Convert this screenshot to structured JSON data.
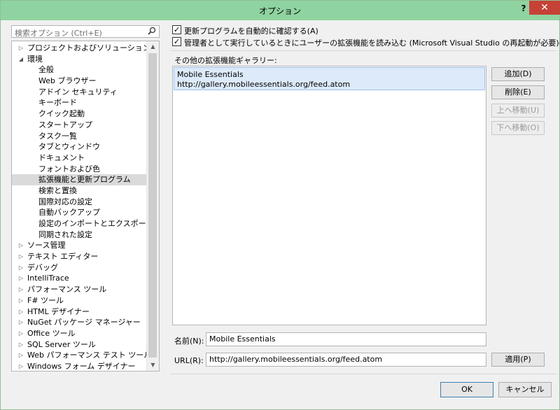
{
  "window": {
    "title": "オプション",
    "help": "?",
    "close": "✕"
  },
  "search": {
    "placeholder": "検索オプション (Ctrl+E)",
    "icon": "search-icon"
  },
  "tree": [
    {
      "label": "プロジェクトおよびソリューション",
      "level": 0,
      "arrow": "▷"
    },
    {
      "label": "環境",
      "level": 0,
      "arrow": "◢"
    },
    {
      "label": "全般",
      "level": 1,
      "arrow": ""
    },
    {
      "label": "Web ブラウザー",
      "level": 1,
      "arrow": ""
    },
    {
      "label": "アドイン セキュリティ",
      "level": 1,
      "arrow": ""
    },
    {
      "label": "キーボード",
      "level": 1,
      "arrow": ""
    },
    {
      "label": "クイック起動",
      "level": 1,
      "arrow": ""
    },
    {
      "label": "スタートアップ",
      "level": 1,
      "arrow": ""
    },
    {
      "label": "タスク一覧",
      "level": 1,
      "arrow": ""
    },
    {
      "label": "タブとウィンドウ",
      "level": 1,
      "arrow": ""
    },
    {
      "label": "ドキュメント",
      "level": 1,
      "arrow": ""
    },
    {
      "label": "フォントおよび色",
      "level": 1,
      "arrow": ""
    },
    {
      "label": "拡張機能と更新プログラム",
      "level": 1,
      "arrow": "",
      "selected": true
    },
    {
      "label": "検索と置換",
      "level": 1,
      "arrow": ""
    },
    {
      "label": "国際対応の設定",
      "level": 1,
      "arrow": ""
    },
    {
      "label": "自動バックアップ",
      "level": 1,
      "arrow": ""
    },
    {
      "label": "設定のインポートとエクスポート",
      "level": 1,
      "arrow": ""
    },
    {
      "label": "同期された設定",
      "level": 1,
      "arrow": ""
    },
    {
      "label": "ソース管理",
      "level": 0,
      "arrow": "▷"
    },
    {
      "label": "テキスト エディター",
      "level": 0,
      "arrow": "▷"
    },
    {
      "label": "デバッグ",
      "level": 0,
      "arrow": "▷"
    },
    {
      "label": "IntelliTrace",
      "level": 0,
      "arrow": "▷"
    },
    {
      "label": "パフォーマンス ツール",
      "level": 0,
      "arrow": "▷"
    },
    {
      "label": "F# ツール",
      "level": 0,
      "arrow": "▷"
    },
    {
      "label": "HTML デザイナー",
      "level": 0,
      "arrow": "▷"
    },
    {
      "label": "NuGet パッケージ マネージャー",
      "level": 0,
      "arrow": "▷"
    },
    {
      "label": "Office ツール",
      "level": 0,
      "arrow": "▷"
    },
    {
      "label": "SQL Server ツール",
      "level": 0,
      "arrow": "▷"
    },
    {
      "label": "Web パフォーマンス テスト ツール",
      "level": 0,
      "arrow": "▷"
    },
    {
      "label": "Windows フォーム デザイナー",
      "level": 0,
      "arrow": "▷"
    }
  ],
  "scrollbar": {
    "up": "▲",
    "down": "▼"
  },
  "options": {
    "auto_update": {
      "label": "更新プログラムを自動的に確認する(A)",
      "checked": true
    },
    "admin_load": {
      "label": "管理者として実行しているときにユーザーの拡張機能を読み込む (Microsoft Visual Studio の再起動が必要)(L)",
      "checked": true
    }
  },
  "gallery": {
    "label": "その他の拡張機能ギャラリー:",
    "items": [
      {
        "name": "Mobile Essentials",
        "url": "http://gallery.mobileessentials.org/feed.atom"
      }
    ]
  },
  "buttons": {
    "add": "追加(D)",
    "remove": "削除(E)",
    "move_up": "上へ移動(U)",
    "move_down": "下へ移動(O)",
    "apply": "適用(P)",
    "ok": "OK",
    "cancel": "キャンセル"
  },
  "fields": {
    "name_label": "名前(N):",
    "name_value": "Mobile Essentials",
    "url_label": "URL(R):",
    "url_value": "http://gallery.mobileessentials.org/feed.atom"
  },
  "colors": {
    "titlebar": "#8fd3a0",
    "close": "#c64237",
    "selected_item": "#ddeaf9"
  }
}
